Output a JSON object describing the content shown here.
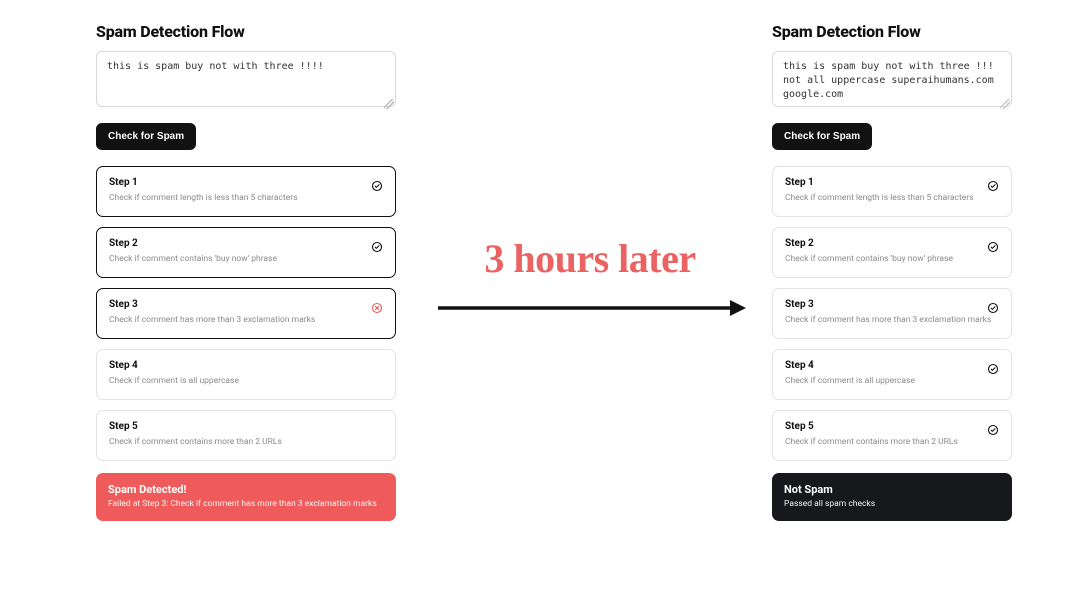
{
  "annotation": {
    "text": "3 hours later"
  },
  "left": {
    "title": "Spam Detection Flow",
    "input_value": "this is spam buy not with three !!!!",
    "button": "Check for Spam",
    "steps": [
      {
        "title": "Step 1",
        "desc": "Check if comment length is less than 5 characters",
        "state": "pass",
        "highlight": true
      },
      {
        "title": "Step 2",
        "desc": "Check if comment contains 'buy now' phrase",
        "state": "pass",
        "highlight": true
      },
      {
        "title": "Step 3",
        "desc": "Check if comment has more than 3 exclamation marks",
        "state": "fail",
        "highlight": true
      },
      {
        "title": "Step 4",
        "desc": "Check if comment is all uppercase",
        "state": "none",
        "highlight": false
      },
      {
        "title": "Step 5",
        "desc": "Check if comment contains more than 2 URLs",
        "state": "none",
        "highlight": false
      }
    ],
    "result": {
      "kind": "spam",
      "title": "Spam Detected!",
      "sub": "Failed at Step 3: Check if comment has more than 3 exclamation marks"
    }
  },
  "right": {
    "title": "Spam Detection Flow",
    "input_value": "this is spam buy not with three !!! not all uppercase superaihumans.com google.com",
    "button": "Check for Spam",
    "steps": [
      {
        "title": "Step 1",
        "desc": "Check if comment length is less than 5 characters",
        "state": "pass",
        "highlight": false
      },
      {
        "title": "Step 2",
        "desc": "Check if comment contains 'buy now' phrase",
        "state": "pass",
        "highlight": false
      },
      {
        "title": "Step 3",
        "desc": "Check if comment has more than 3 exclamation marks",
        "state": "pass",
        "highlight": false
      },
      {
        "title": "Step 4",
        "desc": "Check if comment is all uppercase",
        "state": "pass",
        "highlight": false
      },
      {
        "title": "Step 5",
        "desc": "Check if comment contains more than 2 URLs",
        "state": "pass",
        "highlight": false
      }
    ],
    "result": {
      "kind": "ok",
      "title": "Not Spam",
      "sub": "Passed all spam checks"
    }
  }
}
